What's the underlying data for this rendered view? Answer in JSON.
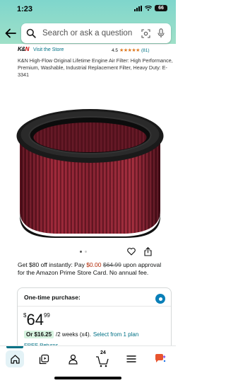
{
  "status": {
    "time": "1:23",
    "battery": "66"
  },
  "search": {
    "placeholder": "Search or ask a question"
  },
  "store": {
    "logo_left": "K&",
    "logo_right": "N",
    "link": "Visit the Store",
    "rating": "4.5",
    "stars": "★★★★★",
    "rating_count": "(81)"
  },
  "product": {
    "title": "K&N High-Flow Original Lifetime Engine Air Filter: High Performance, Premium, Washable, Industrial Replacement Filter, Heavy Duty: E-3341"
  },
  "promo": {
    "line_start": "Get $80 off instantly: Pay ",
    "pay_price": "$0.00",
    "space": " ",
    "old_price": "$64.99",
    "line_end": " upon approval for the Amazon Prime Store Card. No annual fee."
  },
  "purchase": {
    "label": "One-time purchase:",
    "currency": "$",
    "whole": "64",
    "fraction": "99",
    "installment_amount": "Or $16.25",
    "installment_terms": "/2 weeks (x4).",
    "installment_link": "Select from 1 plan",
    "free_returns": "FREE Returns"
  },
  "nav": {
    "cart_count": "24"
  },
  "colors": {
    "accent": "#007185",
    "price_red": "#b12704",
    "header_teal": "#7fd6cc",
    "filter_red": "#8b1a2b"
  }
}
